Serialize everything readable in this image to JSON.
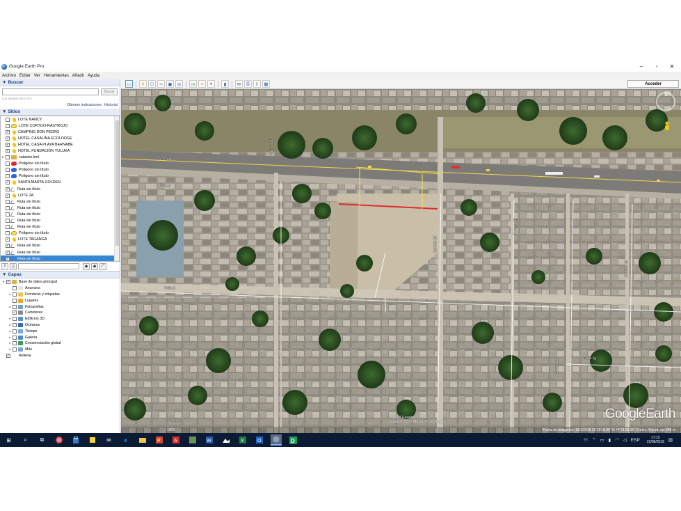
{
  "window": {
    "title": "Google Earth Pro",
    "controls": [
      "–",
      "▫",
      "✕"
    ]
  },
  "menu": [
    "Archivo",
    "Editar",
    "Ver",
    "Herramientas",
    "Añadir",
    "Ayuda"
  ],
  "search": {
    "header": "Buscar",
    "placeholder": "",
    "button": "Buscar",
    "hint": "p.ej. ejemplo, hint, hint, ...",
    "link_directions": "Obtener indicaciones",
    "link_history": "Historial"
  },
  "places": {
    "header": "Sitios",
    "items": [
      {
        "label": "LOTE NANCY",
        "checked": false,
        "icon": "pin-icon",
        "expandable": false
      },
      {
        "label": "LOTE CORTIJO-RASTROJO",
        "checked": false,
        "icon": "polygon-yellow-icon",
        "expandable": false
      },
      {
        "label": "CAMPING DON PEDRO",
        "checked": true,
        "icon": "pin-icon",
        "expandable": false
      },
      {
        "label": "HOTEL CASALINA ECOLODGE",
        "checked": true,
        "icon": "pin-icon",
        "expandable": false
      },
      {
        "label": "HOTEL CASA PLAYA BERNABÉ",
        "checked": true,
        "icon": "pin-icon",
        "expandable": false
      },
      {
        "label": "HOTEL FUNDACIÓN YULUKA",
        "checked": true,
        "icon": "pin-icon",
        "expandable": false
      },
      {
        "label": "catastro.kml",
        "checked": false,
        "icon": "folder-icon",
        "expandable": true
      },
      {
        "label": "Polígono sin título",
        "checked": false,
        "icon": "polygon-red-icon",
        "expandable": false
      },
      {
        "label": "Polígono sin título",
        "checked": false,
        "icon": "polygon-blue-icon",
        "expandable": false
      },
      {
        "label": "Polígono sin título",
        "checked": false,
        "icon": "polygon-blue-icon",
        "expandable": false
      },
      {
        "label": "SANTA MARTA GOLDEN",
        "checked": true,
        "icon": "pin-icon",
        "expandable": false
      },
      {
        "label": "Ruta sin título",
        "checked": true,
        "icon": "path-icon",
        "expandable": false
      },
      {
        "label": "LOTE 2A",
        "checked": true,
        "icon": "pin-icon",
        "expandable": false
      },
      {
        "label": "Ruta sin título",
        "checked": false,
        "icon": "path-icon",
        "expandable": false
      },
      {
        "label": "Ruta sin título",
        "checked": false,
        "icon": "path-icon",
        "expandable": false
      },
      {
        "label": "Ruta sin título",
        "checked": false,
        "icon": "path-icon",
        "expandable": false
      },
      {
        "label": "Ruta sin título",
        "checked": false,
        "icon": "path-icon",
        "expandable": false
      },
      {
        "label": "Ruta sin título",
        "checked": false,
        "icon": "path-icon",
        "expandable": false
      },
      {
        "label": "Polígono sin título",
        "checked": false,
        "icon": "polygon-yellow-icon",
        "expandable": false
      },
      {
        "label": "LOTE TAGANGA",
        "checked": true,
        "icon": "pin-icon",
        "expandable": false
      },
      {
        "label": "Ruta sin título",
        "checked": true,
        "icon": "path-icon",
        "expandable": false
      },
      {
        "label": "Ruta sin título",
        "checked": true,
        "icon": "path-icon",
        "expandable": false
      },
      {
        "label": "Ruta sin título",
        "checked": true,
        "icon": "path-icon",
        "expandable": false,
        "selected": true
      }
    ]
  },
  "layers": {
    "header": "Capas",
    "items": [
      {
        "label": "Base de datos principal",
        "checked": true,
        "color": "#d8b24a",
        "expandable": true,
        "indent": 0
      },
      {
        "label": "Anuncios",
        "checked": false,
        "color": "#e6e6e6",
        "expandable": false,
        "indent": 1
      },
      {
        "label": "Fronteras y etiquetas",
        "checked": false,
        "color": "#e6c74a",
        "expandable": true,
        "indent": 1
      },
      {
        "label": "Lugares",
        "checked": false,
        "color": "#f1a61b",
        "expandable": false,
        "indent": 1
      },
      {
        "label": "Fotografías",
        "checked": false,
        "color": "#6aa0d8",
        "expandable": true,
        "indent": 1
      },
      {
        "label": "Carreteras",
        "checked": true,
        "color": "#8a8a8a",
        "expandable": false,
        "indent": 1
      },
      {
        "label": "Edificios 3D",
        "checked": false,
        "color": "#5e8fcf",
        "expandable": true,
        "indent": 1
      },
      {
        "label": "Océanos",
        "checked": false,
        "color": "#2e6dc2",
        "expandable": true,
        "indent": 1
      },
      {
        "label": "Tiempo",
        "checked": false,
        "color": "#6ab0e0",
        "expandable": true,
        "indent": 1
      },
      {
        "label": "Galería",
        "checked": false,
        "color": "#4a8ad0",
        "expandable": true,
        "indent": 1
      },
      {
        "label": "Concienciación global",
        "checked": false,
        "color": "#3c9a5a",
        "expandable": true,
        "indent": 1
      },
      {
        "label": "Más",
        "checked": false,
        "color": "#7aa7d6",
        "expandable": true,
        "indent": 1
      },
      {
        "label": "Relieve",
        "checked": true,
        "color": "#ffffff",
        "expandable": false,
        "indent": 0
      }
    ]
  },
  "toolbar": {
    "buttons": [
      "sidebar-icon",
      "placemark-icon",
      "polygon-icon",
      "path-icon",
      "overlay-icon",
      "tour-icon",
      "history-icon",
      "sun-icon",
      "planets-icon",
      "ruler-icon",
      "email-icon",
      "print-icon",
      "save-image-icon",
      "maps-icon"
    ],
    "sign_in": "Acceder"
  },
  "map": {
    "labels": [
      {
        "text": "Calle 2",
        "key": "calle2a"
      },
      {
        "text": "Carrera 20",
        "key": "carrera20"
      },
      {
        "text": "Carrera 18",
        "key": "carrera18"
      },
      {
        "text": "Calle 3",
        "key": "calle3"
      },
      {
        "text": "Carrera 16",
        "key": "carrera16"
      },
      {
        "text": "Carrera 15",
        "key": "carrera15"
      },
      {
        "text": "Carrera 13",
        "key": "carrera13"
      },
      {
        "text": "Calle 3a",
        "key": "calle3a"
      }
    ],
    "copyright_lines": [
      "© 2018 Google",
      "Image © 2019 Maxar Technologies"
    ],
    "status": "Fecha de imágenes: 12/1/2018   11°15'18.06\" N   74°11'38.36\" O   elev.   9 m   alt. ojo   248 m",
    "logo_google": "Google",
    "logo_earth": "Earth",
    "compass_n": "N",
    "scale": "1970"
  },
  "taskbar": {
    "apps": [
      "windows-icon",
      "search-icon",
      "task-view-icon",
      "chrome-icon",
      "store-icon",
      "notes-icon",
      "mail-icon",
      "edge-icon",
      "file-explorer-icon",
      "powerpoint-icon",
      "acrobat-icon",
      "calculator-icon",
      "word-icon",
      "photos-icon",
      "excel-icon",
      "outlook-icon",
      "google-earth-icon",
      "app-d-icon"
    ],
    "language": "ESP",
    "time": "17:12",
    "date": "22/08/2019",
    "colors": {
      "chrome": "#e8453c",
      "store": "#f0b400",
      "notes": "#f7d23a",
      "mail": "#ffffff",
      "edge": "#2f8de4",
      "explorer": "#f4c542",
      "powerpoint": "#d04a2a",
      "acrobat": "#d82b2b",
      "calculator": "#6c8f55",
      "word": "#2b5aa8",
      "photos": "#ffffff",
      "excel": "#1d7a45",
      "outlook": "#1f64c0",
      "earth": "#8fa0b3",
      "appd": "#1f9b55"
    }
  }
}
